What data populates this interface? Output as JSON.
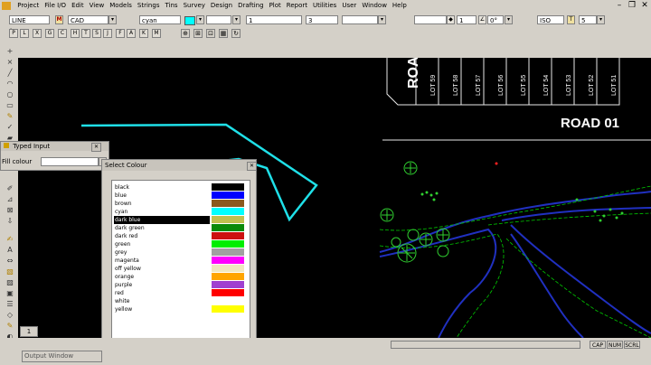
{
  "menu": [
    "Project",
    "File I/O",
    "Edit",
    "View",
    "Models",
    "Strings",
    "Tins",
    "Survey",
    "Design",
    "Drafting",
    "Plot",
    "Report",
    "Utilities",
    "User",
    "Window",
    "Help"
  ],
  "toolbar1": {
    "entity": "LINE",
    "model_button": "M",
    "model": "CAD",
    "colour": "cyan",
    "weight": "1",
    "style": "3",
    "angle_value": "1",
    "angle_deg": "0°",
    "text_style": "ISO",
    "text_button": "T",
    "size": "5"
  },
  "mode_buttons": [
    "P",
    "L",
    "X",
    "G",
    "C",
    "H",
    "T",
    "S",
    "J",
    "F",
    "A",
    "K",
    "M"
  ],
  "canvas": {
    "road_vertical_label": "ROAD",
    "road_label": "ROAD 01",
    "lots": [
      "LOT 59",
      "LOT 58",
      "LOT 57",
      "LOT 56",
      "LOT 55",
      "LOT 54",
      "LOT 53",
      "LOT 52",
      "LOT 51"
    ]
  },
  "typed_input": {
    "title": "Typed Input",
    "field_label": "Fill colour",
    "field_value": ""
  },
  "select_colour": {
    "title": "Select Colour",
    "selected": "dark blue",
    "colours": [
      {
        "name": "black",
        "hex": "#000000"
      },
      {
        "name": "blue",
        "hex": "#0000ff"
      },
      {
        "name": "brown",
        "hex": "#8b5a1e"
      },
      {
        "name": "cyan",
        "hex": "#00ffff"
      },
      {
        "name": "dark blue",
        "hex": "#c0c050"
      },
      {
        "name": "dark green",
        "hex": "#0a8a0a"
      },
      {
        "name": "dark red",
        "hex": "#cc1010"
      },
      {
        "name": "green",
        "hex": "#00ee00"
      },
      {
        "name": "grey",
        "hex": "#a0a0a0"
      },
      {
        "name": "magenta",
        "hex": "#ff00ff"
      },
      {
        "name": "off yellow",
        "hex": "#f0e8c0"
      },
      {
        "name": "orange",
        "hex": "#ffa500"
      },
      {
        "name": "purple",
        "hex": "#a040d0"
      },
      {
        "name": "red",
        "hex": "#ff0000"
      },
      {
        "name": "white",
        "hex": "#ffffff"
      },
      {
        "name": "yellow",
        "hex": "#ffff00"
      }
    ]
  },
  "tab": "1",
  "status": {
    "output_window": "Output Window",
    "cap": "CAP",
    "num": "NUM",
    "scrl": "SCRL"
  }
}
